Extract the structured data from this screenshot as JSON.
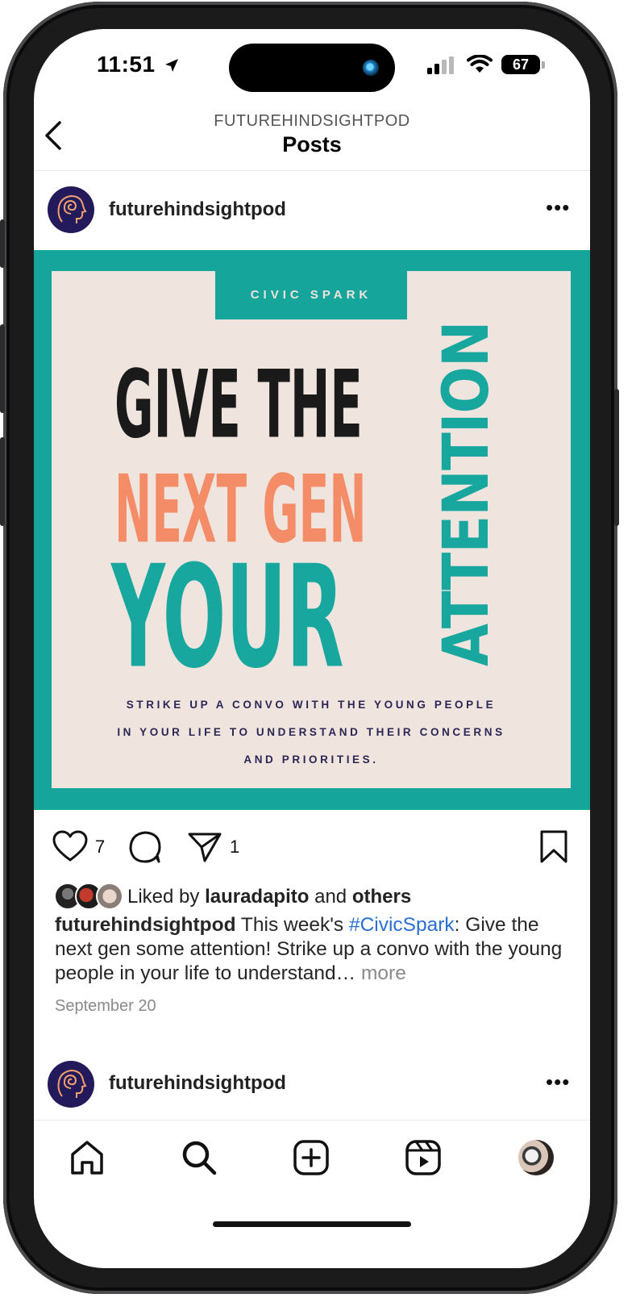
{
  "status_bar": {
    "time": "11:51",
    "battery": "67",
    "icons": [
      "location-arrow-icon",
      "signal-icon",
      "wifi-icon",
      "battery-icon"
    ]
  },
  "header": {
    "account": "FUTUREHINDSIGHTPOD",
    "title": "Posts",
    "back_icon": "chevron-left-icon"
  },
  "post": {
    "username": "futurehindsightpod",
    "menu_icon": "more-horizontal-icon",
    "image": {
      "tag": "CIVIC SPARK",
      "line1": "GIVE THE",
      "line2": "NEXT GEN",
      "line3": "YOUR",
      "vertical": "ATTENTION",
      "sub1": "STRIKE UP A CONVO WITH THE YOUNG PEOPLE",
      "sub2": "IN YOUR LIFE TO UNDERSTAND THEIR CONCERNS",
      "sub3": "AND PRIORITIES."
    },
    "like_count": "7",
    "share_count": "1",
    "liked_by_prefix": "Liked by ",
    "liked_by_user": "lauradapito",
    "liked_by_and": " and ",
    "liked_by_others": "others",
    "caption_user": "futurehindsightpod",
    "caption_pre": " This week's ",
    "caption_hashtag": "#CivicSpark",
    "caption_post": ": Give the next gen some attention! Strike up a convo with the young people in your life to understand…",
    "caption_more": " more",
    "date": "September 20"
  },
  "next_post": {
    "username": "futurehindsightpod"
  },
  "tab_bar": {
    "items": [
      "home-icon",
      "search-icon",
      "new-post-icon",
      "reels-icon",
      "profile-avatar"
    ]
  },
  "colors": {
    "teal": "#16a59b",
    "coral": "#f48c67",
    "cream": "#efe4de",
    "navy": "#2b2654",
    "link": "#2c6fd3"
  }
}
